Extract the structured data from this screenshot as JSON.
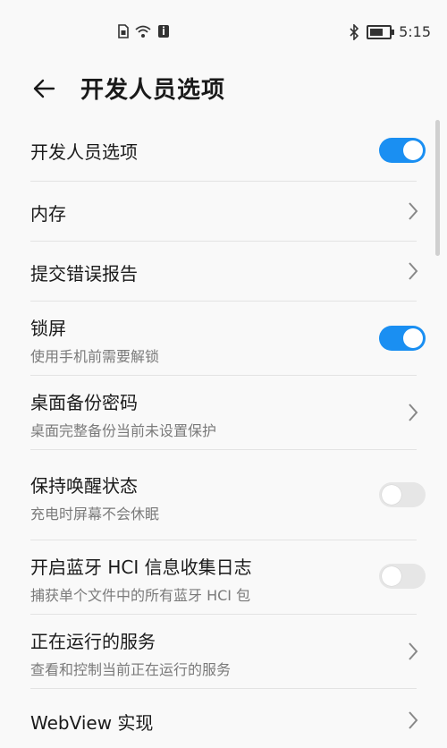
{
  "status_bar": {
    "time": "5:15",
    "left_icons": [
      "sim-icon",
      "wifi-icon",
      "notification-icon"
    ],
    "right_icons": [
      "bluetooth-icon",
      "battery-icon"
    ]
  },
  "header": {
    "title": "开发人员选项"
  },
  "accent_color": "#1a8ff2",
  "items": [
    {
      "title": "开发人员选项",
      "subtitle": "",
      "control": "toggle",
      "state": "on"
    },
    {
      "title": "内存",
      "subtitle": "",
      "control": "chevron"
    },
    {
      "title": "提交错误报告",
      "subtitle": "",
      "control": "chevron"
    },
    {
      "title": "锁屏",
      "subtitle": "使用手机前需要解锁",
      "control": "toggle",
      "state": "on"
    },
    {
      "title": "桌面备份密码",
      "subtitle": "桌面完整备份当前未设置保护",
      "control": "chevron"
    },
    {
      "title": "保持唤醒状态",
      "subtitle": "充电时屏幕不会休眠",
      "control": "toggle",
      "state": "off"
    },
    {
      "title": "开启蓝牙 HCI 信息收集日志",
      "subtitle": "捕获单个文件中的所有蓝牙 HCI 包",
      "control": "toggle",
      "state": "off"
    },
    {
      "title": "正在运行的服务",
      "subtitle": "查看和控制当前正在运行的服务",
      "control": "chevron"
    },
    {
      "title": "WebView 实现",
      "subtitle": "",
      "control": "chevron"
    }
  ]
}
